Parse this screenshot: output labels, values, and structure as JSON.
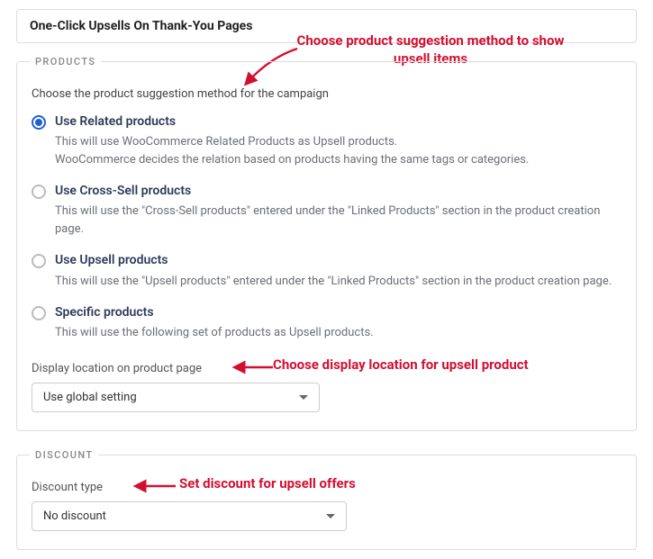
{
  "header": {
    "title": "One-Click Upsells On Thank-You Pages"
  },
  "annotations": {
    "top": "Choose product suggestion method to show upsell items",
    "middle": "Choose display location for upsell product",
    "bottom": "Set discount for upsell offers"
  },
  "products": {
    "legend": "PRODUCTS",
    "intro": "Choose the product suggestion method for the campaign",
    "options": [
      {
        "label": "Use Related products",
        "desc": "This will use WooCommerce Related Products as Upsell products.",
        "desc2": "WooCommerce decides the relation based on products having the same tags or categories.",
        "selected": true
      },
      {
        "label": "Use Cross-Sell products",
        "desc": "This will use the \"Cross-Sell products\" entered under the \"Linked Products\" section in the product creation page.",
        "selected": false
      },
      {
        "label": "Use Upsell products",
        "desc": "This will use the \"Upsell products\" entered under the \"Linked Products\" section in the product creation page.",
        "selected": false
      },
      {
        "label": "Specific products",
        "desc": "This will use the following set of products as Upsell products.",
        "selected": false
      }
    ],
    "location_label": "Display location on product page",
    "location_value": "Use global setting"
  },
  "discount": {
    "legend": "DISCOUNT",
    "type_label": "Discount type",
    "type_value": "No discount"
  }
}
